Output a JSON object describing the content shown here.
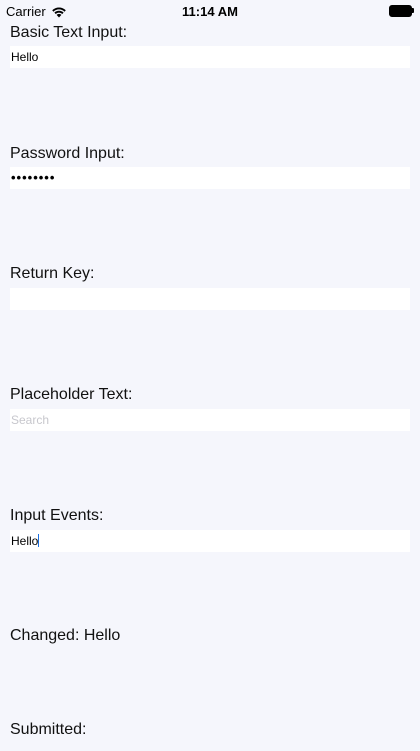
{
  "status_bar": {
    "carrier": "Carrier",
    "time": "11:14 AM"
  },
  "sections": {
    "basic": {
      "label": "Basic Text Input:",
      "value": "Hello"
    },
    "password": {
      "label": "Password Input:",
      "masked_value": "••••••••"
    },
    "return_key": {
      "label": "Return Key:",
      "value": ""
    },
    "placeholder": {
      "label": "Placeholder Text:",
      "placeholder": "Search"
    },
    "events": {
      "label": "Input Events:",
      "value": "Hello"
    }
  },
  "changed": {
    "text": "Changed: Hello"
  },
  "submitted": {
    "text": "Submitted:"
  },
  "colors": {
    "background": "#f5f6fc",
    "field_background": "#ffffff",
    "caret": "#1a6fe0",
    "placeholder": "#c7c7cd"
  }
}
